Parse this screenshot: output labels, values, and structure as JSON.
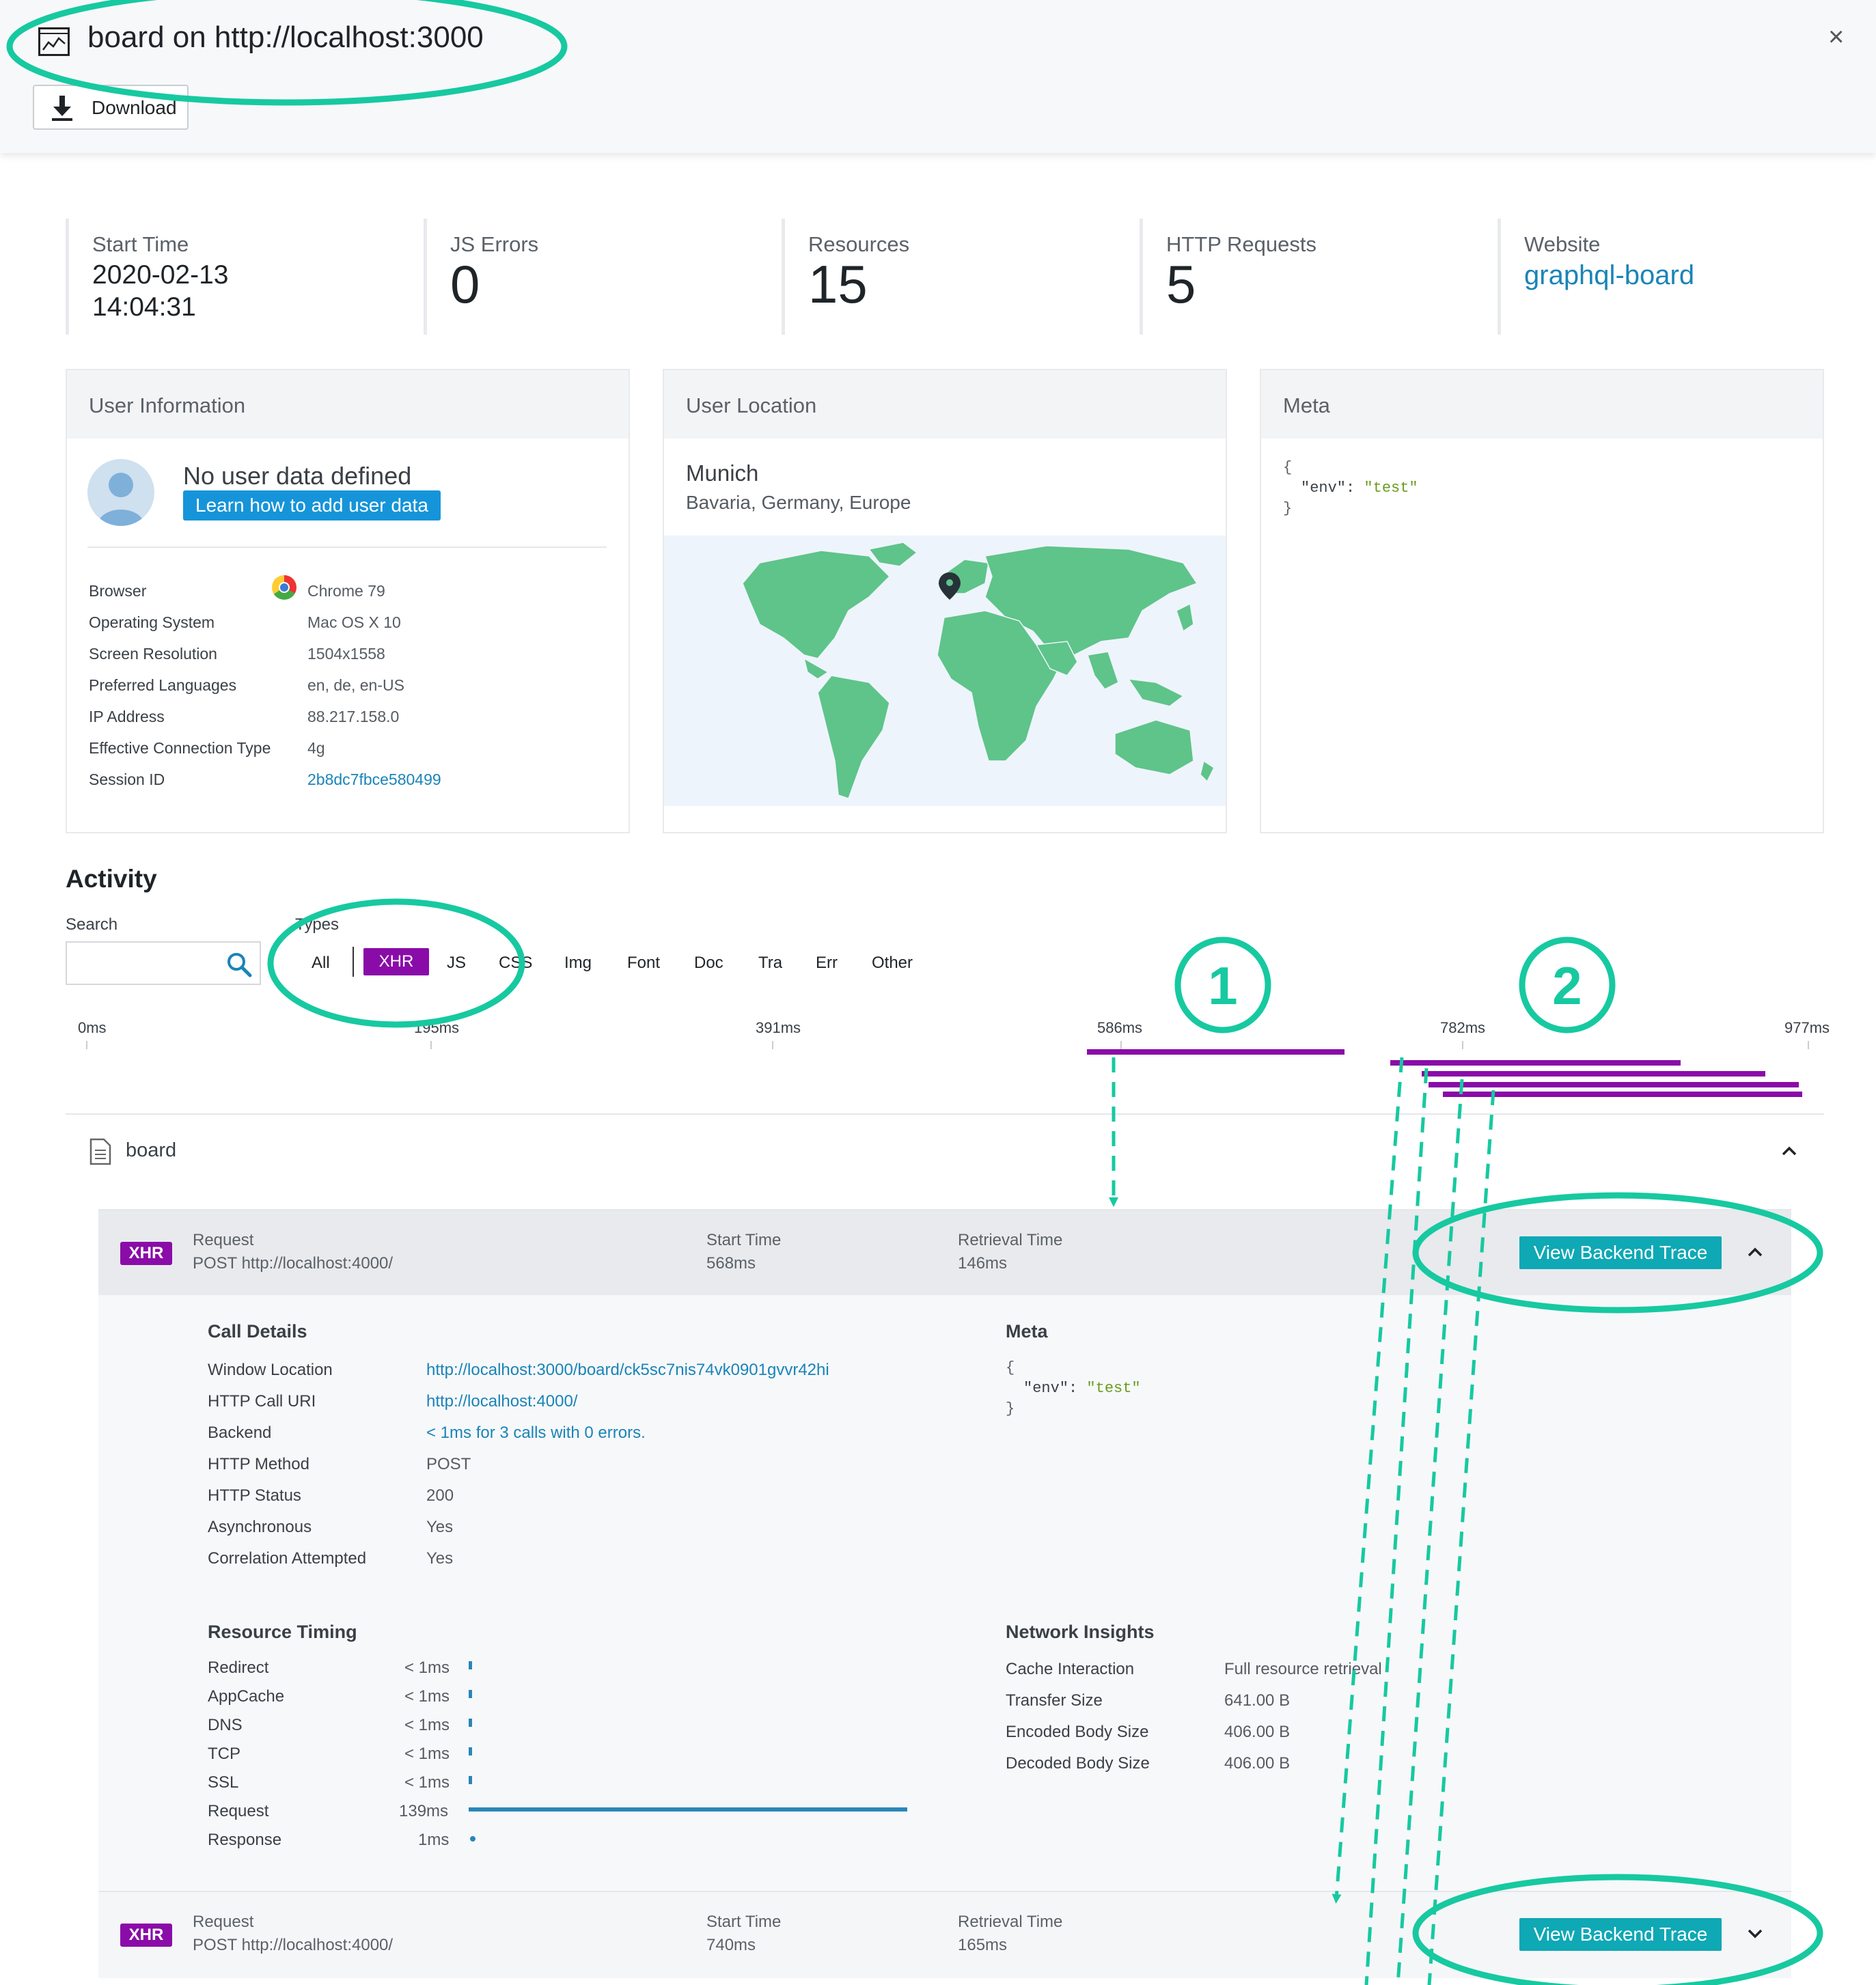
{
  "header": {
    "title": "board on http://localhost:3000",
    "download_label": "Download",
    "close_symbol": "×"
  },
  "stats": [
    {
      "label": "Start Time",
      "value_line1": "2020-02-13",
      "value_line2": "14:04:31"
    },
    {
      "label": "JS Errors",
      "value": "0"
    },
    {
      "label": "Resources",
      "value": "15"
    },
    {
      "label": "HTTP Requests",
      "value": "5"
    },
    {
      "label": "Website",
      "value": "graphql-board"
    }
  ],
  "user_info": {
    "title": "User Information",
    "no_user": "No user data defined",
    "learn_label": "Learn how to add user data",
    "rows": [
      {
        "key": "Browser",
        "value": "Chrome 79"
      },
      {
        "key": "Operating System",
        "value": "Mac OS X 10"
      },
      {
        "key": "Screen Resolution",
        "value": "1504x1558"
      },
      {
        "key": "Preferred Languages",
        "value": "en, de, en-US"
      },
      {
        "key": "IP Address",
        "value": "88.217.158.0"
      },
      {
        "key": "Effective Connection Type",
        "value": "4g"
      },
      {
        "key": "Session ID",
        "value": "2b8dc7fbce580499"
      }
    ]
  },
  "user_location": {
    "title": "User Location",
    "city": "Munich",
    "region": "Bavaria, Germany, Europe"
  },
  "meta_panel": {
    "title": "Meta",
    "open": "{",
    "key": "\"env\":",
    "value": "\"test\"",
    "close": "}"
  },
  "activity": {
    "title": "Activity",
    "search_label": "Search",
    "search_placeholder": "",
    "types_label": "Types",
    "filters": [
      "All",
      "XHR",
      "JS",
      "CSS",
      "Img",
      "Font",
      "Doc",
      "Tra",
      "Err",
      "Other"
    ],
    "active_filter": "XHR",
    "ticks": [
      "0ms",
      "195ms",
      "391ms",
      "586ms",
      "782ms",
      "977ms"
    ],
    "timeline_ms": {
      "max": 977,
      "bars": [
        {
          "start": 568,
          "duration": 146
        },
        {
          "start": 740,
          "duration": 165
        },
        {
          "start": 758,
          "duration": 195
        },
        {
          "start": 762,
          "duration": 210
        },
        {
          "start": 770,
          "duration": 204
        }
      ]
    },
    "group_label": "board"
  },
  "requests": [
    {
      "badge": "XHR",
      "request_label": "Request",
      "request_value": "POST http://localhost:4000/",
      "start_label": "Start Time",
      "start_value": "568ms",
      "retrieval_label": "Retrieval Time",
      "retrieval_value": "146ms",
      "button": "View Backend Trace",
      "chevron": "⌃"
    },
    {
      "badge": "XHR",
      "request_label": "Request",
      "request_value": "POST http://localhost:4000/",
      "start_label": "Start Time",
      "start_value": "740ms",
      "retrieval_label": "Retrieval Time",
      "retrieval_value": "165ms",
      "button": "View Backend Trace",
      "chevron": "⌄"
    }
  ],
  "call_details": {
    "title": "Call Details",
    "rows": [
      {
        "key": "Window Location",
        "value": "http://localhost:3000/board/ck5sc7nis74vk0901gvvr42hi",
        "link": true
      },
      {
        "key": "HTTP Call URI",
        "value": "http://localhost:4000/",
        "link": true
      },
      {
        "key": "Backend",
        "value": "< 1ms for 3 calls with 0 errors.",
        "link": true
      },
      {
        "key": "HTTP Method",
        "value": "POST"
      },
      {
        "key": "HTTP Status",
        "value": "200"
      },
      {
        "key": "Asynchronous",
        "value": "Yes"
      },
      {
        "key": "Correlation Attempted",
        "value": "Yes"
      }
    ]
  },
  "detail_meta": {
    "title": "Meta",
    "open": "{",
    "key": "\"env\":",
    "value": "\"test\"",
    "close": "}"
  },
  "resource_timing": {
    "title": "Resource Timing",
    "rows": [
      {
        "key": "Redirect",
        "value": "< 1ms"
      },
      {
        "key": "AppCache",
        "value": "< 1ms"
      },
      {
        "key": "DNS",
        "value": "< 1ms"
      },
      {
        "key": "TCP",
        "value": "< 1ms"
      },
      {
        "key": "SSL",
        "value": "< 1ms"
      },
      {
        "key": "Request",
        "value": "139ms"
      },
      {
        "key": "Response",
        "value": "1ms"
      }
    ]
  },
  "network_insights": {
    "title": "Network Insights",
    "rows": [
      {
        "key": "Cache Interaction",
        "value": "Full resource retrieval"
      },
      {
        "key": "Transfer Size",
        "value": "641.00 B"
      },
      {
        "key": "Encoded Body Size",
        "value": "406.00 B"
      },
      {
        "key": "Decoded Body Size",
        "value": "406.00 B"
      }
    ]
  },
  "annotations": {
    "marker1": "1",
    "marker2": "2"
  },
  "colors": {
    "accent_purple": "#8a0ca8",
    "annotation_green": "#17c9a0",
    "teal_button": "#0fa8b5",
    "map_land": "#5ec48a",
    "link_blue": "#1a84b8"
  }
}
